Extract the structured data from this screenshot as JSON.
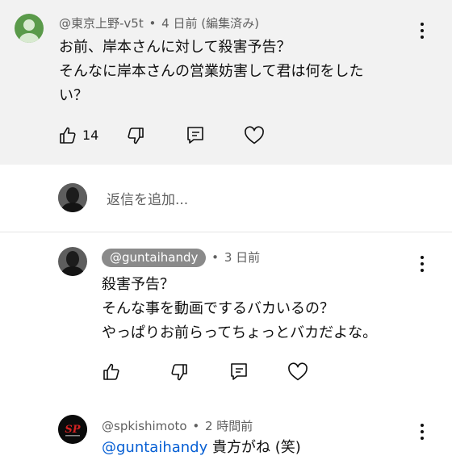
{
  "comments": [
    {
      "handle": "@東京上野-v5t",
      "separator": "•",
      "time": "4 日前 (編集済み)",
      "lines": [
        "お前、岸本さんに対して殺害予告？",
        "そんなに岸本さんの営業妨害して君は何をした",
        "い？"
      ],
      "like_count": "14",
      "avatar_color": "#5a9a4a"
    },
    {
      "handle": "@guntaihandy",
      "separator": "•",
      "time": "3 日前",
      "lines": [
        "殺害予告？",
        "そんな事を動画でするバカいるの？",
        "やっぱりお前らってちょっとバカだよな。"
      ]
    },
    {
      "handle": "@spkishimoto",
      "separator": "•",
      "time": "2 時間前",
      "mention": "@guntaihandy",
      "text_after_mention": " 貴方がね (笑)",
      "avatar_text": "SP"
    }
  ],
  "reply_box": {
    "placeholder": "返信を追加..."
  },
  "colors": {
    "highlight_bg": "#f2f2f2",
    "chip_bg": "#8a8a8a",
    "mention": "#065fd4"
  }
}
